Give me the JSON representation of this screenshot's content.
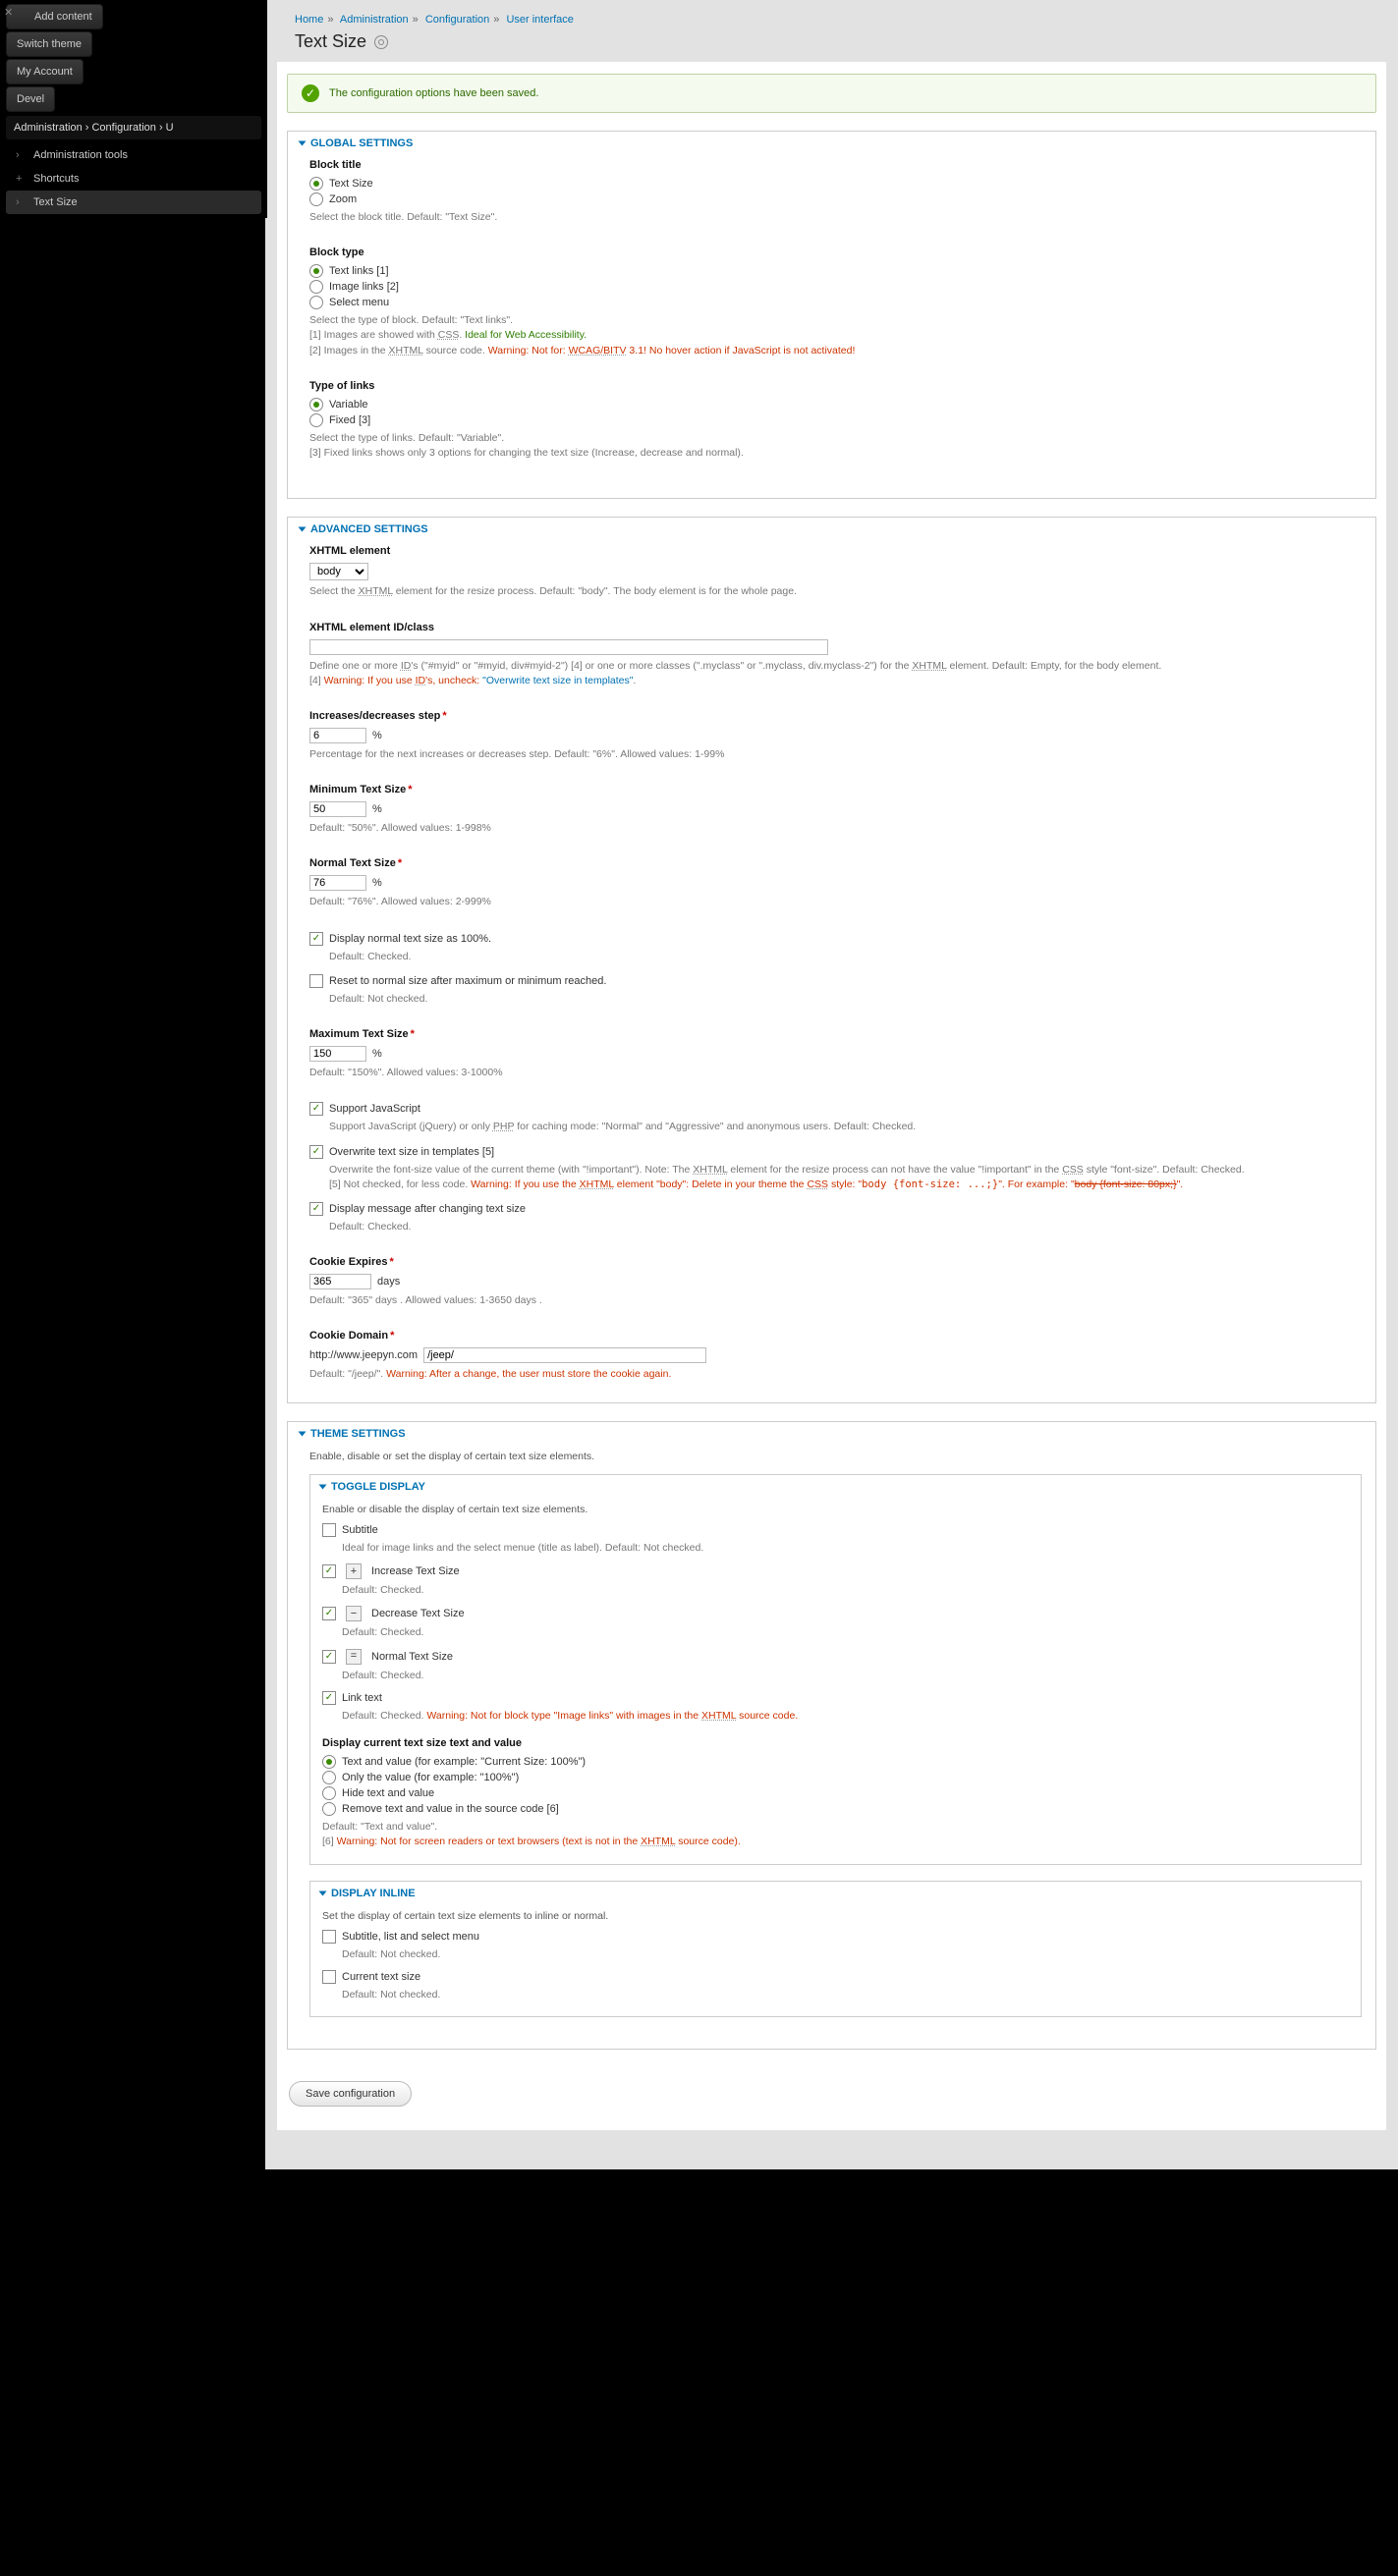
{
  "sidebar": {
    "buttons": [
      "Add content",
      "Switch theme",
      "My Account",
      "Devel"
    ],
    "breadcrumb": "Administration  ›  Configuration  ›  U",
    "items": [
      {
        "label": "Administration tools",
        "glyph": "›",
        "active": false
      },
      {
        "label": "Shortcuts",
        "glyph": "+",
        "active": false
      },
      {
        "label": "Text Size",
        "glyph": "›",
        "active": true
      }
    ]
  },
  "breadcrumb": [
    "Home",
    "Administration",
    "Configuration",
    "User interface"
  ],
  "page_title": "Text Size",
  "status_msg": "The configuration options have been saved.",
  "global": {
    "legend": "GLOBAL SETTINGS",
    "block_title": {
      "label": "Block title",
      "opts": [
        "Text Size",
        "Zoom"
      ],
      "sel": 0,
      "desc": "Select the block title. Default: \"Text Size\"."
    },
    "block_type": {
      "label": "Block type",
      "opts": [
        "Text links [1]",
        "Image links [2]",
        "Select menu"
      ],
      "sel": 0,
      "desc_pre": "Select the type of block. Default: \"Text links\".",
      "desc_l1a": "[1] Images are showed with ",
      "desc_l1b": "CSS",
      "desc_l1c": ". ",
      "desc_l1_green": "Ideal for Web Accessibility.",
      "desc_l2a": "[2] Images in the ",
      "desc_l2b": "XHTML",
      "desc_l2c": " source code. ",
      "desc_l2_warn": "Warning: Not for: ",
      "desc_l2_wcag": "WCAG/BITV",
      "desc_l2_rest": " 3.1! No hover action if JavaScript is not activated!"
    },
    "type_links": {
      "label": "Type of links",
      "opts": [
        "Variable",
        "Fixed [3]"
      ],
      "sel": 0,
      "desc1": "Select the type of links. Default: \"Variable\".",
      "desc2": "[3] Fixed links shows only 3 options for changing the text size (Increase, decrease and normal)."
    }
  },
  "advanced": {
    "legend": "ADVANCED SETTINGS",
    "xhtml_el": {
      "label": "XHTML element",
      "value": "body",
      "desc_a": "Select the ",
      "desc_b": "XHTML",
      "desc_c": " element for the resize process. Default: \"body\". The body element is for the whole page."
    },
    "xhtml_id": {
      "label": "XHTML element ID/class",
      "value": "",
      "desc_a": "Define one or more ",
      "desc_b": "ID",
      "desc_c": "'s (\"#myid\" or \"#myid, div#myid-2\") [4] or one or more classes (\".myclass\" or \".myclass, div.myclass-2\") for the ",
      "desc_d": "XHTML",
      "desc_e": " element. Default: Empty, for the body element.",
      "warn_a": "[4] ",
      "warn_b": "Warning: If you use ",
      "warn_c": "ID",
      "warn_d": "'s, uncheck: ",
      "warn_link": "\"Overwrite text size in templates\"",
      "warn_end": "."
    },
    "step": {
      "label": "Increases/decreases step",
      "value": "6",
      "unit": "%",
      "desc": "Percentage for the next increases or decreases step. Default: \"6%\". Allowed values: 1-99%"
    },
    "min": {
      "label": "Minimum Text Size",
      "value": "50",
      "unit": "%",
      "desc": "Default: \"50%\". Allowed values: 1-998%"
    },
    "normal": {
      "label": "Normal Text Size",
      "value": "76",
      "unit": "%",
      "desc": "Default: \"76%\". Allowed values: 2-999%"
    },
    "disp100": {
      "label": "Display normal text size as 100%.",
      "sel": true,
      "desc": "Default: Checked."
    },
    "reset": {
      "label": "Reset to normal size after maximum or minimum reached.",
      "sel": false,
      "desc": "Default: Not checked."
    },
    "max": {
      "label": "Maximum Text Size",
      "value": "150",
      "unit": "%",
      "desc": "Default: \"150%\". Allowed values: 3-1000%"
    },
    "js": {
      "label": "Support JavaScript",
      "sel": true,
      "desc_a": "Support JavaScript (jQuery) or only ",
      "desc_b": "PHP",
      "desc_c": " for caching mode: \"Normal\" and \"Aggressive\" and anonymous users. Default: Checked."
    },
    "ow": {
      "label": "Overwrite text size in templates [5]",
      "sel": true,
      "d1a": "Overwrite the font-size value of the current theme (with \"!important\"). Note: The ",
      "d1b": "XHTML",
      "d1c": " element for the resize process can not have the value \"!important\" in the ",
      "d1d": "CSS",
      "d1e": " style \"font-size\". Default: Checked.",
      "w_a": "[5] Not checked, for less code. ",
      "w_b": "Warning: If you use the ",
      "w_c": "XHTML",
      "w_d": " element \"body\": Delete in your theme the ",
      "w_e": "CSS",
      "w_f": " style: \"",
      "w_code": "body {font-size: ...;}",
      "w_g": "\". For example: \"",
      "w_strike": "body {font-size: 80px;}",
      "w_h": "\"."
    },
    "msg": {
      "label": "Display message after changing text size",
      "sel": true,
      "desc": "Default: Checked."
    },
    "cookie_exp": {
      "label": "Cookie Expires",
      "value": "365",
      "unit": "days",
      "desc": "Default: \"365\" days . Allowed values: 1-3650 days ."
    },
    "cookie_dom": {
      "label": "Cookie Domain",
      "prefix": "http://www.jeepyn.com",
      "value": "/jeep/",
      "d_a": "Default: \"/jeep/\". ",
      "d_warn": "Warning: After a change, the user must store the cookie again."
    }
  },
  "theme": {
    "legend": "THEME SETTINGS",
    "intro": "Enable, disable or set the display of certain text size elements.",
    "toggle": {
      "legend": "TOGGLE DISPLAY",
      "intro": "Enable or disable the display of certain text size elements.",
      "subtitle": {
        "label": "Subtitle",
        "sel": false,
        "desc": "Ideal for image links and the select menue (title as label). Default: Not checked."
      },
      "inc": {
        "label": "Increase Text Size",
        "sel": true,
        "desc": "Default: Checked.",
        "glyph": "+"
      },
      "dec": {
        "label": "Decrease Text Size",
        "sel": true,
        "desc": "Default: Checked.",
        "glyph": "−"
      },
      "norm": {
        "label": "Normal Text Size",
        "sel": true,
        "desc": "Default: Checked.",
        "glyph": "="
      },
      "link": {
        "label": "Link text",
        "sel": true,
        "d_a": "Default: Checked. ",
        "d_warn": "Warning: Not for block type \"Image links\" with images in the ",
        "d_b": "XHTML",
        "d_c": " source code."
      },
      "display_current": {
        "label": "Display current text size text and value",
        "opts": [
          "Text and value (for example: \"Current Size: 100%\")",
          "Only the value (for example: \"100%\")",
          "Hide text and value",
          "Remove text and value in the source code [6]"
        ],
        "sel": 0,
        "d_a": "Default: \"Text and value\".",
        "w_a": "[6] ",
        "w_b": "Warning: Not for screen readers or text browsers (text is not in the ",
        "w_c": "XHTML",
        "w_d": " source code)."
      }
    },
    "inline": {
      "legend": "DISPLAY INLINE",
      "intro": "Set the display of certain text size elements to inline or normal.",
      "sub": {
        "label": "Subtitle, list and select menu",
        "sel": false,
        "desc": "Default: Not checked."
      },
      "cur": {
        "label": "Current text size",
        "sel": false,
        "desc": "Default: Not checked."
      }
    }
  },
  "save_label": "Save configuration"
}
